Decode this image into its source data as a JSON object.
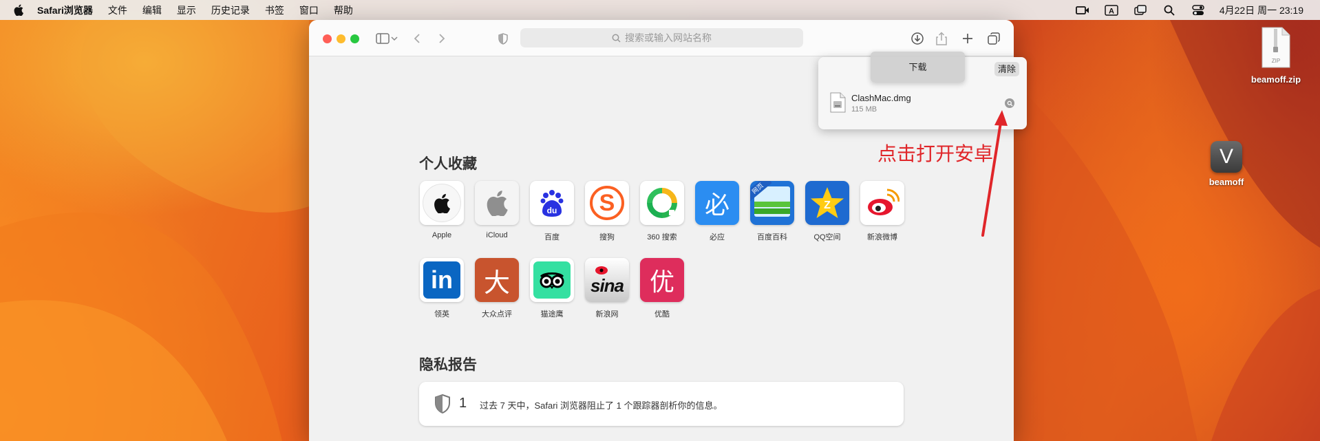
{
  "menubar": {
    "app_name": "Safari浏览器",
    "items": [
      "文件",
      "编辑",
      "显示",
      "历史记录",
      "书签",
      "窗口",
      "帮助"
    ],
    "datetime": "4月22日 周一 23:19",
    "status_icons": [
      "screen-record-icon",
      "input-method-icon",
      "window-icon",
      "search-icon",
      "control-center-icon"
    ]
  },
  "safari": {
    "address_placeholder": "搜索或输入网站名称",
    "downloads_tooltip": "下载",
    "downloads": {
      "clear_label": "清除",
      "file_name": "ClashMac.dmg",
      "file_size": "115 MB"
    },
    "favorites_title": "个人收藏",
    "favorites": [
      {
        "label": "Apple",
        "icon": "apple-logo-icon"
      },
      {
        "label": "iCloud",
        "icon": "icloud-apple-icon"
      },
      {
        "label": "百度",
        "icon": "baidu-paw-icon",
        "text": "du"
      },
      {
        "label": "搜狗",
        "icon": "sogou-icon",
        "text": "S"
      },
      {
        "label": "360 搜索",
        "icon": "360-search-icon"
      },
      {
        "label": "必应",
        "icon": "bing-icon",
        "text": "必"
      },
      {
        "label": "百度百科",
        "icon": "baidu-baike-icon",
        "text": "网页"
      },
      {
        "label": "QQ空间",
        "icon": "qzone-star-icon",
        "text": "Z"
      },
      {
        "label": "新浪微博",
        "icon": "weibo-icon"
      },
      {
        "label": "领英",
        "icon": "linkedin-icon",
        "text": "in"
      },
      {
        "label": "大众点评",
        "icon": "dianping-icon",
        "text": "大"
      },
      {
        "label": "猫途鹰",
        "icon": "tripadvisor-owl-icon"
      },
      {
        "label": "新浪网",
        "icon": "sina-icon",
        "text": "sina"
      },
      {
        "label": "优酷",
        "icon": "youku-icon",
        "text": "优"
      }
    ],
    "privacy_title": "隐私报告",
    "privacy_count": "1",
    "privacy_text": "过去 7 天中，Safari 浏览器阻止了 1 个跟踪器剖析你的信息。"
  },
  "annotation": {
    "text": "点击打开安卓",
    "color": "#e0262a"
  },
  "desktop": {
    "icons": [
      {
        "label": "beamoff.zip",
        "icon": "zip-file-icon",
        "badge": "ZIP"
      },
      {
        "label": "beamoff",
        "icon": "beamoff-app-icon",
        "glyph": "V"
      }
    ]
  },
  "colors": {
    "menubar_bg": "#ececec",
    "close": "#ff5f57",
    "minimize": "#febc2e",
    "zoom": "#28c840",
    "annotation_red": "#e0262a"
  }
}
